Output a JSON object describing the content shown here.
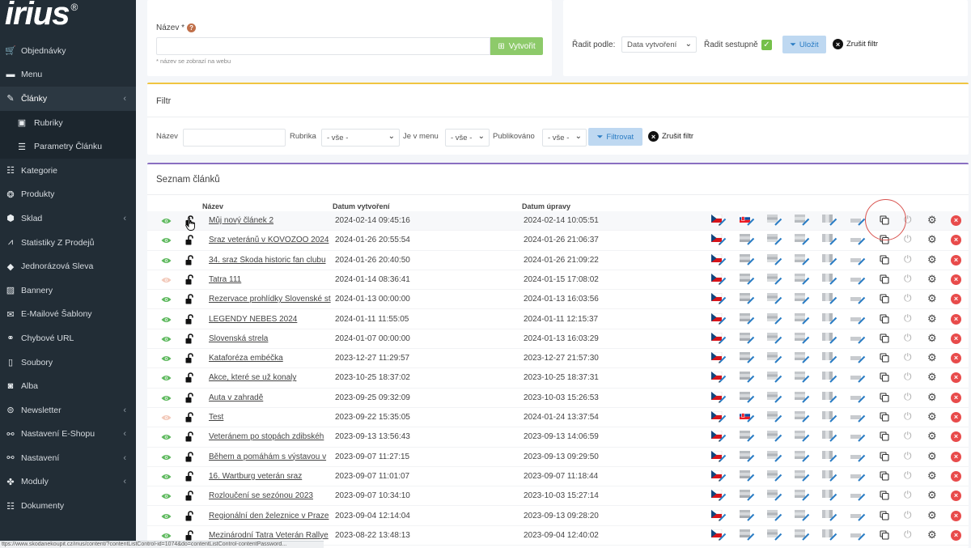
{
  "brand": {
    "name": "irius",
    "mark": "®"
  },
  "sidebar": {
    "items": [
      {
        "label": "Objednávky",
        "icon": "cart-icon",
        "glyph": "🛒",
        "chevron": false,
        "active": false,
        "sub": false
      },
      {
        "label": "Menu",
        "icon": "folder-icon",
        "glyph": "▬",
        "chevron": false,
        "active": false,
        "sub": false
      },
      {
        "label": "Články",
        "icon": "pencil-icon",
        "glyph": "✎",
        "chevron": true,
        "active": true,
        "sub": false
      },
      {
        "label": "Rubriky",
        "icon": "image-icon",
        "glyph": "▣",
        "chevron": false,
        "active": false,
        "sub": true
      },
      {
        "label": "Parametry Článku",
        "icon": "sliders-icon",
        "glyph": "☰",
        "chevron": false,
        "active": false,
        "sub": true
      },
      {
        "label": "Kategorie",
        "icon": "list-icon",
        "glyph": "☷",
        "chevron": false,
        "active": false,
        "sub": false
      },
      {
        "label": "Produkty",
        "icon": "gear-cube-icon",
        "glyph": "❂",
        "chevron": false,
        "active": false,
        "sub": false
      },
      {
        "label": "Sklad",
        "icon": "boxes-icon",
        "glyph": "⬢",
        "chevron": true,
        "active": false,
        "sub": false
      },
      {
        "label": "Statistiky Z Prodejů",
        "icon": "chart-icon",
        "glyph": "⩘",
        "chevron": false,
        "active": false,
        "sub": false
      },
      {
        "label": "Jednorázová Sleva",
        "icon": "tag-icon",
        "glyph": "◆",
        "chevron": false,
        "active": false,
        "sub": false
      },
      {
        "label": "Bannery",
        "icon": "picture-icon",
        "glyph": "▨",
        "chevron": false,
        "active": false,
        "sub": false
      },
      {
        "label": "E-Mailové Šablony",
        "icon": "envelope-icon",
        "glyph": "✉",
        "chevron": false,
        "active": false,
        "sub": false
      },
      {
        "label": "Chybové URL",
        "icon": "link-icon",
        "glyph": "⚭",
        "chevron": false,
        "active": false,
        "sub": false
      },
      {
        "label": "Soubory",
        "icon": "file-icon",
        "glyph": "▯",
        "chevron": false,
        "active": false,
        "sub": false
      },
      {
        "label": "Alba",
        "icon": "camera-icon",
        "glyph": "◙",
        "chevron": false,
        "active": false,
        "sub": false
      },
      {
        "label": "Newsletter",
        "icon": "newsletter-icon",
        "glyph": "⊜",
        "chevron": true,
        "active": false,
        "sub": false
      },
      {
        "label": "Nastavení E-Shopu",
        "icon": "settings-link-icon",
        "glyph": "⚯",
        "chevron": true,
        "active": false,
        "sub": false
      },
      {
        "label": "Nastavení",
        "icon": "settings-link-icon",
        "glyph": "⚯",
        "chevron": true,
        "active": false,
        "sub": false
      },
      {
        "label": "Moduly",
        "icon": "puzzle-icon",
        "glyph": "✤",
        "chevron": true,
        "active": false,
        "sub": false
      },
      {
        "label": "Dokumenty",
        "icon": "list-icon",
        "glyph": "☷",
        "chevron": false,
        "active": false,
        "sub": false
      }
    ]
  },
  "create": {
    "label": "Název *",
    "help": "?",
    "value": "",
    "button": "Vytvořit",
    "hint": "* název se zobrazí na webu"
  },
  "sort": {
    "label": "Řadit podle:",
    "selected": "Data vytvoření",
    "desc_label": "Řadit sestupně",
    "save": "Uložit",
    "cancel": "Zrušit filtr"
  },
  "filter": {
    "title": "Filtr",
    "name_label": "Název",
    "name_value": "",
    "rubrika_label": "Rubrika",
    "rubrika_value": "- vše -",
    "menu_label": "Je v menu",
    "menu_value": "- vše -",
    "pub_label": "Publikováno",
    "pub_value": "- vše -",
    "apply": "Filtrovat",
    "cancel": "Zrušit filtr"
  },
  "list": {
    "title": "Seznam článků",
    "headers": {
      "name": "Název",
      "created": "Datum vytvoření",
      "updated": "Datum úpravy"
    },
    "rows": [
      {
        "name": "Můj nový článek 2",
        "created": "2024-02-14 09:45:16",
        "updated": "2024-02-14 10:05:51",
        "visible": true,
        "sk": true
      },
      {
        "name": "Sraz veteránů v KOVOZOO 2024",
        "created": "2024-01-26 20:55:54",
        "updated": "2024-01-26 21:06:37",
        "visible": true,
        "sk": false
      },
      {
        "name": "34. sraz Škoda historic fan clubu",
        "created": "2024-01-26 20:40:50",
        "updated": "2024-01-26 21:09:22",
        "visible": true,
        "sk": false
      },
      {
        "name": "Tatra 111",
        "created": "2024-01-14 08:36:41",
        "updated": "2024-01-15 17:08:02",
        "visible": false,
        "sk": false
      },
      {
        "name": "Rezervace prohlídky Slovenské st",
        "created": "2024-01-13 00:00:00",
        "updated": "2024-01-13 16:03:56",
        "visible": true,
        "sk": false
      },
      {
        "name": "LEGENDY NEBES 2024",
        "created": "2024-01-11 11:55:05",
        "updated": "2024-01-11 12:15:37",
        "visible": true,
        "sk": false
      },
      {
        "name": "Slovenská strela",
        "created": "2024-01-07 00:00:00",
        "updated": "2024-01-13 16:03:29",
        "visible": true,
        "sk": false
      },
      {
        "name": "Kataforéza embéčka",
        "created": "2023-12-27 11:29:57",
        "updated": "2023-12-27 21:57:30",
        "visible": true,
        "sk": false
      },
      {
        "name": "Akce, které se už konaly",
        "created": "2023-10-25 18:37:02",
        "updated": "2023-10-25 18:37:31",
        "visible": true,
        "sk": false
      },
      {
        "name": "Auta v zahradě",
        "created": "2023-09-25 09:32:09",
        "updated": "2023-10-03 15:26:53",
        "visible": true,
        "sk": false
      },
      {
        "name": "Test",
        "created": "2023-09-22 15:35:05",
        "updated": "2024-01-24 13:37:54",
        "visible": false,
        "sk": true
      },
      {
        "name": "Veteránem po stopách zdibskéh",
        "created": "2023-09-13 13:56:43",
        "updated": "2023-09-13 14:06:59",
        "visible": true,
        "sk": false
      },
      {
        "name": "Během a pomáhám s výstavou v",
        "created": "2023-09-07 11:27:15",
        "updated": "2023-09-13 09:29:50",
        "visible": true,
        "sk": false
      },
      {
        "name": "16. Wartburg veterán sraz",
        "created": "2023-09-07 11:01:07",
        "updated": "2023-09-07 11:18:44",
        "visible": true,
        "sk": false
      },
      {
        "name": "Rozloučení se sezónou 2023",
        "created": "2023-09-07 10:34:10",
        "updated": "2023-10-03 15:27:14",
        "visible": true,
        "sk": false
      },
      {
        "name": "Regionální den železnice v Praze",
        "created": "2023-09-04 12:14:04",
        "updated": "2023-09-13 09:28:20",
        "visible": true,
        "sk": false
      },
      {
        "name": "Mezinárodní Tatra Veterán Rallye",
        "created": "2023-08-22 13:48:13",
        "updated": "2023-09-04 12:40:02",
        "visible": true,
        "sk": false
      }
    ]
  },
  "statusbar": "ttps://www.skodanekoupit.cz/irius/content/?contentListControl-id=1074&do=contentListControl-contentPassword...",
  "colors": {
    "sidebar": "#222d36",
    "create_btn": "#8dca6a",
    "filter_accent": "#f0c541",
    "list_accent": "#8a6fc1",
    "delete": "#e84b4b",
    "eye": "#5cb85c"
  }
}
